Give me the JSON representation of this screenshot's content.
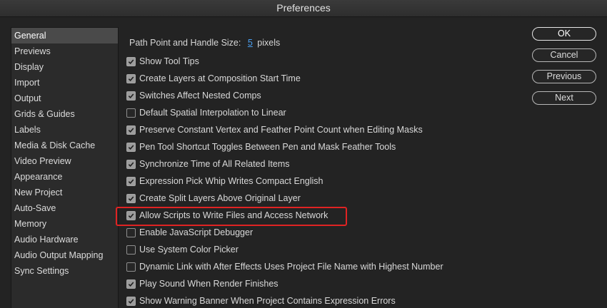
{
  "window": {
    "title": "Preferences"
  },
  "sidebar": {
    "items": [
      {
        "label": "General",
        "selected": true
      },
      {
        "label": "Previews"
      },
      {
        "label": "Display"
      },
      {
        "label": "Import"
      },
      {
        "label": "Output"
      },
      {
        "label": "Grids & Guides"
      },
      {
        "label": "Labels"
      },
      {
        "label": "Media & Disk Cache"
      },
      {
        "label": "Video Preview"
      },
      {
        "label": "Appearance"
      },
      {
        "label": "New Project"
      },
      {
        "label": "Auto-Save"
      },
      {
        "label": "Memory"
      },
      {
        "label": "Audio Hardware"
      },
      {
        "label": "Audio Output Mapping"
      },
      {
        "label": "Sync Settings"
      }
    ]
  },
  "general": {
    "path_point_label": "Path Point and Handle Size:",
    "path_point_value": "5",
    "path_point_unit": "pixels",
    "options": [
      {
        "label": "Show Tool Tips",
        "checked": true
      },
      {
        "label": "Create Layers at Composition Start Time",
        "checked": true
      },
      {
        "label": "Switches Affect Nested Comps",
        "checked": true
      },
      {
        "label": "Default Spatial Interpolation to Linear",
        "checked": false
      },
      {
        "label": "Preserve Constant Vertex and Feather Point Count when Editing Masks",
        "checked": true
      },
      {
        "label": "Pen Tool Shortcut Toggles Between Pen and Mask Feather Tools",
        "checked": true
      },
      {
        "label": "Synchronize Time of All Related Items",
        "checked": true
      },
      {
        "label": "Expression Pick Whip Writes Compact English",
        "checked": true
      },
      {
        "label": "Create Split Layers Above Original Layer",
        "checked": true
      },
      {
        "label": "Allow Scripts to Write Files and Access Network",
        "checked": true
      },
      {
        "label": "Enable JavaScript Debugger",
        "checked": false
      },
      {
        "label": "Use System Color Picker",
        "checked": false
      },
      {
        "label": "Dynamic Link with After Effects Uses Project File Name with Highest Number",
        "checked": false
      },
      {
        "label": "Play Sound When Render Finishes",
        "checked": true
      },
      {
        "label": "Show Warning Banner When Project Contains Expression Errors",
        "checked": true
      }
    ]
  },
  "buttons": {
    "ok": "OK",
    "cancel": "Cancel",
    "previous": "Previous",
    "next": "Next"
  },
  "colors": {
    "background": "#232323",
    "selection": "#4a4a4a",
    "link": "#4a9ff0",
    "highlight_border": "#e02323"
  },
  "icons": {
    "checkbox_checked": "checkmark-icon"
  }
}
